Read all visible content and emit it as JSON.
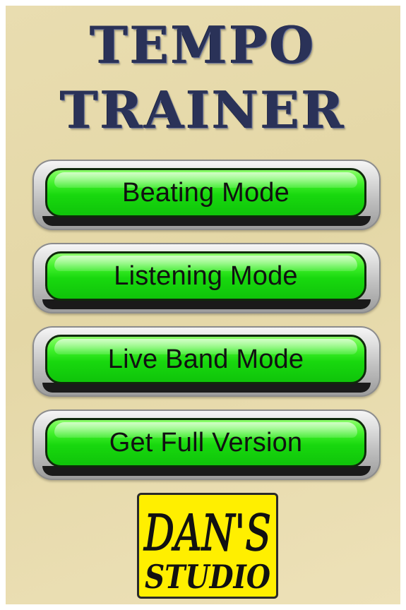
{
  "app": {
    "title_line_1": "TEMPO",
    "title_line_2": "TRAINER"
  },
  "menu": {
    "buttons": [
      {
        "label": "Beating Mode"
      },
      {
        "label": "Listening Mode"
      },
      {
        "label": "Live Band Mode"
      },
      {
        "label": "Get Full Version"
      }
    ]
  },
  "logo": {
    "line_1": "DAN'S",
    "line_2": "STUDIO",
    "background_color": "#ffef00"
  },
  "colors": {
    "title": "#2a3258",
    "button_fill": "#18d80e",
    "button_text": "#111111",
    "background": "#e9ddb0"
  }
}
